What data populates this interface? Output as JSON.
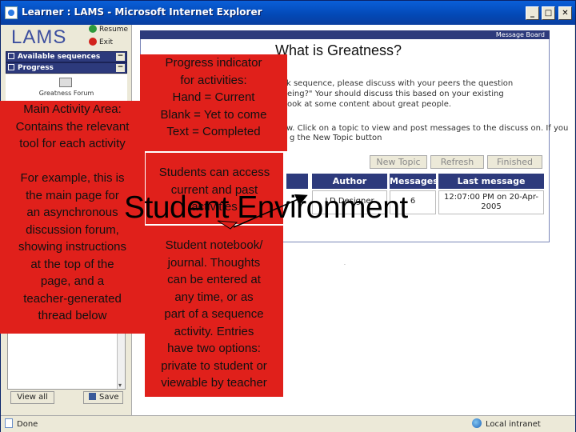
{
  "window": {
    "title": "Learner : LAMS - Microsoft Internet Explorer",
    "controls": {
      "minimize": "_",
      "maximize": "□",
      "close": "✕"
    }
  },
  "left_panel": {
    "logo": "LAMS",
    "resume_label": "Resume",
    "exit_label": "Exit",
    "available_sequences_label": "Available sequences",
    "progress_label": "Progress",
    "toggle_glyph": "−",
    "current_activity": "Greatness Forum",
    "view_all_label": "View all",
    "save_label": "Save"
  },
  "content": {
    "header_label": "Message Board",
    "heading": "What is Greatness?",
    "instructions": [
      "k sequence, please discuss with your peers the question",
      "eing?\" Your should discuss this based on your existing",
      "ook at some content about great people.",
      "w. Click on a topic to view and post messages to the discuss on. If you",
      "g the New Topic button"
    ],
    "buttons": {
      "new_topic": "New Topic",
      "refresh": "Refresh",
      "finished": "Finished"
    },
    "table": {
      "headers": {
        "author": "Author",
        "messages": "Messages",
        "last_message": "Last message"
      },
      "rows": [
        {
          "author": "LD Designer",
          "messages": "6",
          "last_message": "12:07:00 PM on 20-Apr-2005"
        }
      ]
    },
    "status_dot": "."
  },
  "statusbar": {
    "done": "Done",
    "zone": "Local intranet"
  },
  "slide": {
    "title": "Student Environment",
    "callouts": {
      "progress": "Progress indicator\nfor activities:\nHand = Current\nBlank = Yet to come\nText = Completed",
      "main_area": "Main Activity Area:\nContains the relevant\ntool for each activity\n\nFor example, this is\nthe main page for\nan asynchronous\ndiscussion forum,\nshowing instructions\nat the top of the\npage, and a\nteacher-generated\nthread below",
      "students_access": "Students can access\ncurrent and past\nactivities",
      "notebook": "Student notebook/\njournal. Thoughts\ncan be entered at\nany time, or as\npart of a sequence\nactivity. Entries\nhave two options:\nprivate to student or\nviewable by teacher"
    },
    "colors": {
      "callout_bg": "#e0201b",
      "lams_nav": "#2d3a7c"
    }
  }
}
